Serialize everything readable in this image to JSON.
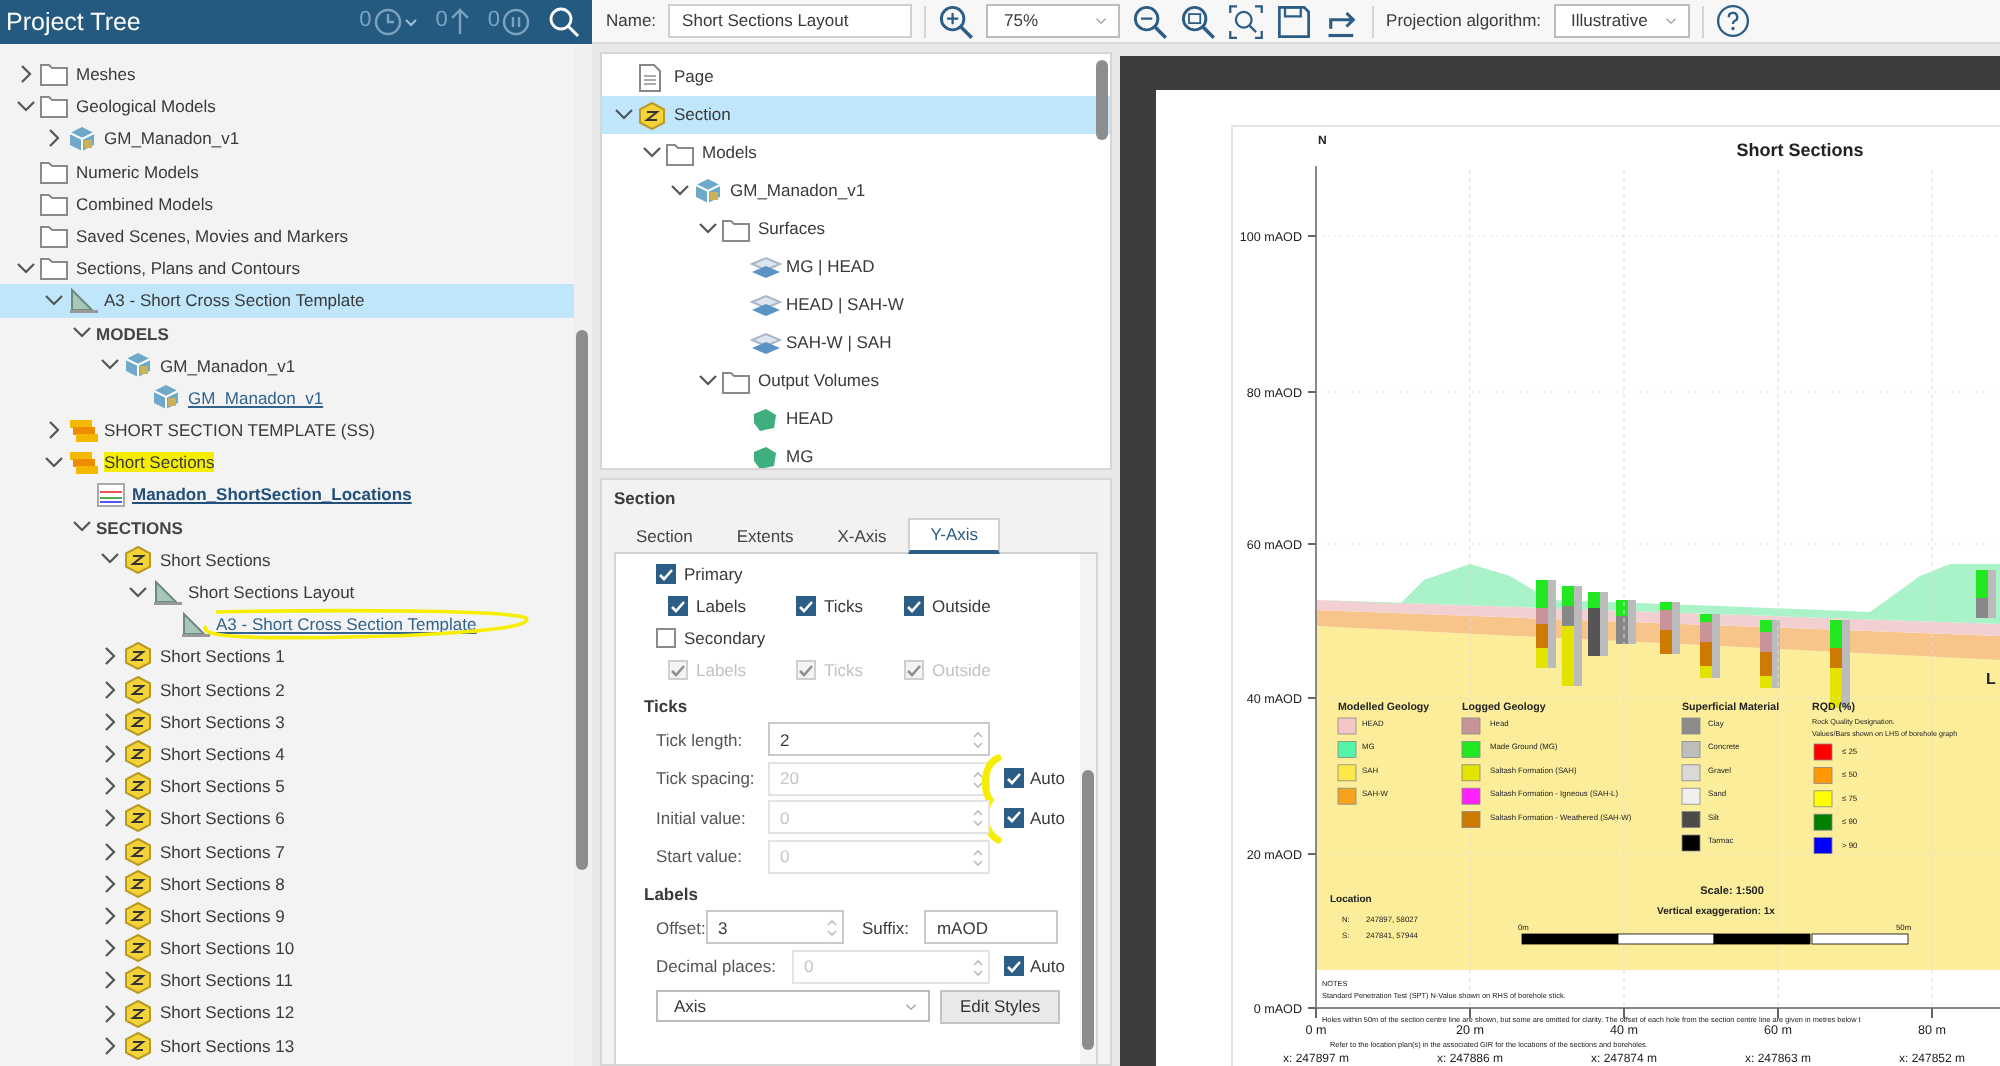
{
  "project_tree": {
    "title": "Project Tree",
    "header_tools": [
      {
        "kind": "history",
        "count": "0"
      },
      {
        "kind": "upload",
        "count": "0"
      },
      {
        "kind": "pause",
        "count": "0"
      },
      {
        "kind": "search"
      }
    ],
    "items": [
      {
        "label": "Meshes",
        "kind": "folder",
        "selected": false,
        "expanded": false
      },
      {
        "label": "Geological Models",
        "kind": "folder",
        "selected": false,
        "expanded": true,
        "children": [
          {
            "label": "GM_Manadon_v1",
            "kind": "model",
            "selected": false,
            "expanded": false
          }
        ]
      },
      {
        "label": "Numeric Models",
        "kind": "folder",
        "selected": false
      },
      {
        "label": "Combined Models",
        "kind": "folder",
        "selected": false
      },
      {
        "label": "Saved Scenes, Movies and Markers",
        "kind": "folder",
        "selected": false
      },
      {
        "label": "Sections, Plans and Contours",
        "kind": "folder",
        "selected": false,
        "expanded": true,
        "children": [
          {
            "label": "A3 - Short Cross Section Template",
            "kind": "layout",
            "selected": true,
            "expanded": true,
            "children": [
              {
                "label": "MODELS",
                "kind": "heading",
                "selected": false,
                "expanded": true,
                "children": [
                  {
                    "label": "GM_Manadon_v1",
                    "kind": "model",
                    "selected": false,
                    "expanded": true,
                    "children": [
                      {
                        "label": "GM_Manadon_v1",
                        "kind": "model-link",
                        "selected": false
                      }
                    ]
                  }
                ]
              }
            ]
          },
          {
            "label": "SHORT SECTION TEMPLATE (SS)",
            "kind": "stack",
            "selected": false,
            "expanded": false
          },
          {
            "label": "Short Sections",
            "kind": "stack",
            "selected": false,
            "expanded": true,
            "highlighted": true,
            "children": [
              {
                "label": "Manadon_ShortSection_Locations",
                "kind": "locations-link",
                "selected": false
              },
              {
                "label": "SECTIONS",
                "kind": "heading",
                "selected": false,
                "expanded": true,
                "children": [
                  {
                    "label": "Short Sections",
                    "kind": "section",
                    "selected": false,
                    "expanded": true,
                    "children": [
                      {
                        "label": "Short Sections Layout",
                        "kind": "layout",
                        "selected": false,
                        "expanded": true,
                        "children": [
                          {
                            "label": "A3 - Short Cross Section Template",
                            "kind": "layout-link",
                            "selected": false,
                            "highlighted": true
                          }
                        ]
                      }
                    ]
                  },
                  {
                    "label": "Short Sections 1",
                    "kind": "section",
                    "selected": false,
                    "expanded": false
                  },
                  {
                    "label": "Short Sections 2",
                    "kind": "section",
                    "selected": false,
                    "expanded": false
                  },
                  {
                    "label": "Short Sections 3",
                    "kind": "section",
                    "selected": false,
                    "expanded": false
                  },
                  {
                    "label": "Short Sections 4",
                    "kind": "section",
                    "selected": false,
                    "expanded": false
                  },
                  {
                    "label": "Short Sections 5",
                    "kind": "section",
                    "selected": false,
                    "expanded": false
                  },
                  {
                    "label": "Short Sections 6",
                    "kind": "section",
                    "selected": false,
                    "expanded": false
                  },
                  {
                    "label": "Short Sections 7",
                    "kind": "section",
                    "selected": false,
                    "expanded": false
                  },
                  {
                    "label": "Short Sections 8",
                    "kind": "section",
                    "selected": false,
                    "expanded": false
                  },
                  {
                    "label": "Short Sections 9",
                    "kind": "section",
                    "selected": false,
                    "expanded": false
                  },
                  {
                    "label": "Short Sections 10",
                    "kind": "section",
                    "selected": false,
                    "expanded": false
                  },
                  {
                    "label": "Short Sections 11",
                    "kind": "section",
                    "selected": false,
                    "expanded": false
                  },
                  {
                    "label": "Short Sections 12",
                    "kind": "section",
                    "selected": false,
                    "expanded": false
                  },
                  {
                    "label": "Short Sections 13",
                    "kind": "section",
                    "selected": false,
                    "expanded": false
                  }
                ]
              }
            ]
          }
        ]
      }
    ]
  },
  "toolbar": {
    "name_label": "Name:",
    "name_value": "Short Sections Layout",
    "zoom_value": "75%",
    "projection_label": "Projection algorithm:",
    "projection_value": "Illustrative"
  },
  "layout_tree": {
    "items": [
      {
        "label": "Page",
        "kind": "page",
        "selected": false
      },
      {
        "label": "Section",
        "kind": "section",
        "selected": true,
        "expanded": true,
        "children": [
          {
            "label": "Models",
            "kind": "folder",
            "selected": false,
            "expanded": true,
            "children": [
              {
                "label": "GM_Manadon_v1",
                "kind": "model",
                "selected": false,
                "expanded": true,
                "children": [
                  {
                    "label": "Surfaces",
                    "kind": "folder",
                    "selected": false,
                    "expanded": true,
                    "children": [
                      {
                        "label": "MG | HEAD",
                        "kind": "surface",
                        "selected": false
                      },
                      {
                        "label": "HEAD | SAH-W",
                        "kind": "surface",
                        "selected": false
                      },
                      {
                        "label": "SAH-W | SAH",
                        "kind": "surface",
                        "selected": false
                      }
                    ]
                  },
                  {
                    "label": "Output Volumes",
                    "kind": "folder",
                    "selected": false,
                    "expanded": true,
                    "children": [
                      {
                        "label": "HEAD",
                        "kind": "volume",
                        "selected": false
                      },
                      {
                        "label": "MG",
                        "kind": "volume",
                        "selected": false
                      }
                    ]
                  }
                ]
              }
            ]
          }
        ]
      }
    ]
  },
  "properties": {
    "title": "Section",
    "tabs": [
      {
        "label": "Section",
        "selected": false
      },
      {
        "label": "Extents",
        "selected": false
      },
      {
        "label": "X-Axis",
        "selected": false
      },
      {
        "label": "Y-Axis",
        "selected": true
      }
    ],
    "primary": {
      "label": "Primary",
      "checked": true,
      "options": [
        {
          "label": "Labels",
          "checked": true,
          "disabled": false
        },
        {
          "label": "Ticks",
          "checked": true,
          "disabled": false
        },
        {
          "label": "Outside",
          "checked": true,
          "disabled": false
        }
      ]
    },
    "secondary": {
      "label": "Secondary",
      "checked": false,
      "options": [
        {
          "label": "Labels",
          "checked": true,
          "disabled": true
        },
        {
          "label": "Ticks",
          "checked": true,
          "disabled": true
        },
        {
          "label": "Outside",
          "checked": true,
          "disabled": true
        }
      ]
    },
    "ticks": {
      "heading": "Ticks",
      "annotated": true,
      "fields": [
        {
          "label": "Tick length:",
          "value": "2",
          "disabled": false
        },
        {
          "label": "Tick spacing:",
          "value": "20",
          "disabled": true,
          "auto": {
            "label": "Auto",
            "checked": true
          }
        },
        {
          "label": "Initial value:",
          "value": "0",
          "disabled": true,
          "auto": {
            "label": "Auto",
            "checked": true
          }
        },
        {
          "label": "Start value:",
          "value": "0",
          "disabled": true
        }
      ]
    },
    "labels": {
      "heading": "Labels",
      "offset": {
        "label": "Offset:",
        "value": "3"
      },
      "suffix": {
        "label": "Suffix:",
        "value": "mAOD"
      },
      "decimal": {
        "label": "Decimal places:",
        "value": "0",
        "disabled": true,
        "auto": {
          "label": "Auto",
          "checked": true
        }
      },
      "style_select": "Axis",
      "edit_button": "Edit Styles"
    }
  },
  "section_view": {
    "title": "Short Sections",
    "north_label": "N",
    "edge_label": "L",
    "y_ticks": [
      "100 mAOD",
      "80 mAOD",
      "60 mAOD",
      "40 mAOD",
      "20 mAOD",
      "0 mAOD"
    ],
    "x_ticks": [
      {
        "distance": "0 m",
        "easting": "x: 247897 m"
      },
      {
        "distance": "20 m",
        "easting": "x: 247886 m"
      },
      {
        "distance": "40 m",
        "easting": "x: 247874 m"
      },
      {
        "distance": "60 m",
        "easting": "x: 247863 m"
      },
      {
        "distance": "80 m",
        "easting": "x: 247852 m"
      }
    ],
    "legends": [
      {
        "heading": "Modelled Geology",
        "entries": [
          {
            "label": "HEAD",
            "color": "#f4c6c8"
          },
          {
            "label": "MG",
            "color": "#55f5a8"
          },
          {
            "label": "SAH",
            "color": "#fde84a"
          },
          {
            "label": "SAH-W",
            "color": "#f5a21d"
          }
        ]
      },
      {
        "heading": "Logged Geology",
        "entries": [
          {
            "label": "Head",
            "color": "#c8949a"
          },
          {
            "label": "Made Ground (MG)",
            "color": "#22e822"
          },
          {
            "label": "Saltash Formation (SAH)",
            "color": "#e3e300"
          },
          {
            "label": "Saltash Formation - Igneous (SAH-L)",
            "color": "#ff22ff"
          },
          {
            "label": "Saltash Formation - Weathered (SAH-W)",
            "color": "#cc7a00"
          }
        ]
      },
      {
        "heading": "Superficial Material",
        "entries": [
          {
            "label": "Clay",
            "color": "#8c8c8c"
          },
          {
            "label": "Concrete",
            "color": "#bdbdbd"
          },
          {
            "label": "Gravel",
            "color": "#d9d9d9"
          },
          {
            "label": "Sand",
            "color": "#efefef"
          },
          {
            "label": "Silt",
            "color": "#4a4a4a"
          },
          {
            "label": "Tarmac",
            "color": "#000000"
          }
        ]
      }
    ],
    "rqd": {
      "heading": "RQD (%)",
      "description": "Rock Quality Designation.",
      "note": "Values/Bars shown on LHS of borehole graph",
      "entries": [
        {
          "label": "≤ 25",
          "color": "#ff0000"
        },
        {
          "label": "≤ 50",
          "color": "#ff9900"
        },
        {
          "label": "≤ 75",
          "color": "#ffff00"
        },
        {
          "label": "≤ 90",
          "color": "#008000"
        },
        {
          "label": "> 90",
          "color": "#0000ff"
        }
      ]
    },
    "location": {
      "heading": "Location",
      "points": [
        {
          "key": "N:",
          "value": "247897, 58027"
        },
        {
          "key": "S:",
          "value": "247841, 57944"
        }
      ]
    },
    "scale": {
      "label": "Scale: 1:500",
      "exaggeration": "Vertical exaggeration: 1x",
      "start": "0m",
      "end": "50m"
    },
    "notes": [
      "NOTES",
      "Standard Penetration Test (SPT) N-Value shown on RHS of borehole stick.",
      "Holes within 50m of the section centre line are shown, but some are omitted for clarity. The offset of each hole from the section centre line are given in metres below t",
      "Refer to the location plan(s) in the associated GIR for the locations of the sections and boreholes."
    ]
  }
}
